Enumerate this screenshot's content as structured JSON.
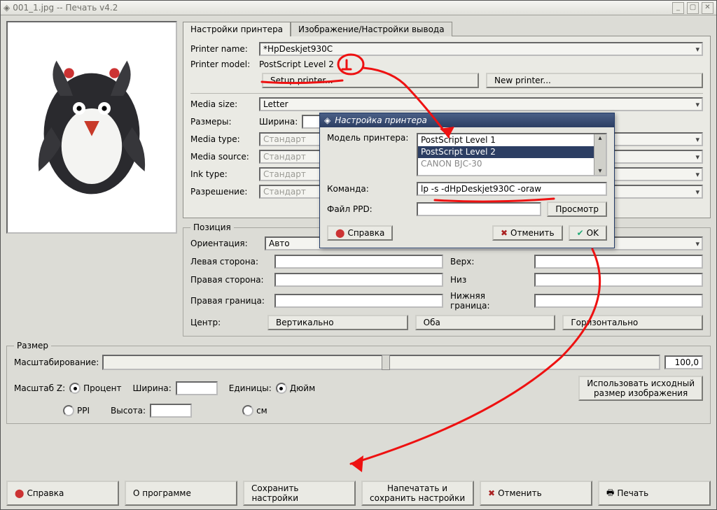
{
  "window": {
    "title": "001_1.jpg -- Печать v4.2"
  },
  "tabs": {
    "printer": "Настройки принтера",
    "image": "Изображение/Настройки вывода"
  },
  "printer": {
    "name_label": "Printer name:",
    "name_value": "*HpDeskjet930C",
    "model_label": "Printer model:",
    "model_value": "PostScript Level 2",
    "setup_btn": "Setup printer...",
    "new_btn": "New printer...",
    "media_size_label": "Media size:",
    "media_size_value": "Letter",
    "dims_label": "Размеры:",
    "width_label": "Ширина:",
    "media_type_label": "Media type:",
    "media_type_value": "Стандарт",
    "media_source_label": "Media source:",
    "media_source_value": "Стандарт",
    "ink_type_label": "Ink type:",
    "ink_type_value": "Стандарт",
    "resolution_label": "Разрешение:",
    "resolution_value": "Стандарт"
  },
  "position": {
    "legend": "Позиция",
    "orientation_label": "Ориентация:",
    "orientation_value": "Авто",
    "left_label": "Левая сторона:",
    "top_label": "Верх:",
    "right_label": "Правая сторона:",
    "bottom_label": "Низ",
    "rborder_label": "Правая граница:",
    "bborder_label": "Нижняя граница:",
    "center_label": "Центр:",
    "vert_btn": "Вертикально",
    "both_btn": "Оба",
    "horiz_btn": "Горизонтально"
  },
  "size": {
    "legend": "Размер",
    "scaling_label": "Масштабирование:",
    "scaling_value": "100,0",
    "scale_z_label": "Масштаб Z:",
    "percent": "Процент",
    "ppi": "PPI",
    "width_label": "Ширина:",
    "height_label": "Высота:",
    "units_label": "Единицы:",
    "inch": "Дюйм",
    "cm": "см",
    "orig_size_btn": "Использовать исходный\nразмер изображения"
  },
  "buttons": {
    "help": "Справка",
    "about": "О программе",
    "save": "Сохранить\nнастройки",
    "print_save": "Напечатать и\nсохранить настройки",
    "cancel": "Отменить",
    "print": "Печать"
  },
  "dialog": {
    "title": "Настройка принтера",
    "model_label": "Модель принтера:",
    "options": [
      "PostScript Level 1",
      "PostScript Level 2",
      "CANON BJC-30"
    ],
    "selected": "PostScript Level 2",
    "command_label": "Команда:",
    "command_value": "lp -s -dHpDeskjet930C -oraw",
    "ppd_label": "Файл PPD:",
    "browse_btn": "Просмотр",
    "help_btn": "Справка",
    "cancel_btn": "Отменить",
    "ok_btn": "OK"
  },
  "icons": {
    "help": "⬤",
    "cancel": "✖",
    "ok": "✔",
    "print": "🖶",
    "diamond": "◈"
  }
}
